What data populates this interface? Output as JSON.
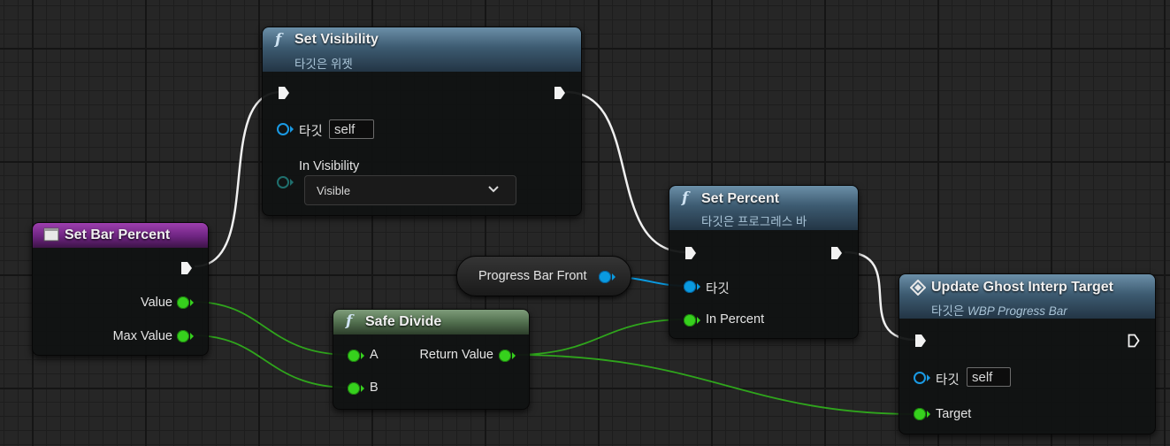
{
  "colors": {
    "exec_wire": "#f2f2f2",
    "float_wire": "#36d11d",
    "object_wire": "#0a9ae0",
    "function_header": "#3d5b71",
    "pure_function_header": "#52704f",
    "event_header": "#6d2480"
  },
  "nodes": {
    "set_visibility": {
      "icon": "function-icon",
      "title": "Set Visibility",
      "subtitle": "타깃은 위젯",
      "target_label": "타깃",
      "target_value": "self",
      "in_visibility_label": "In Visibility",
      "visibility_selected": "Visible"
    },
    "set_bar_percent": {
      "icon": "event-icon",
      "title": "Set Bar Percent",
      "outputs": [
        "Value",
        "Max Value"
      ]
    },
    "safe_divide": {
      "icon": "function-icon",
      "title": "Safe Divide",
      "inputs": [
        "A",
        "B"
      ],
      "output": "Return Value"
    },
    "set_percent": {
      "icon": "function-icon",
      "title": "Set Percent",
      "subtitle": "타깃은 프로그레스 바",
      "target_label": "타깃",
      "in_percent_label": "In Percent"
    },
    "progress_bar_front": {
      "label": "Progress Bar Front"
    },
    "update_ghost": {
      "icon": "interface-diamond-icon",
      "title": "Update Ghost Interp Target",
      "subtitle_prefix": "타깃은 ",
      "subtitle_italic": "WBP Progress Bar",
      "target_label": "타깃",
      "target_value": "self",
      "target_pin_label": "Target"
    }
  }
}
